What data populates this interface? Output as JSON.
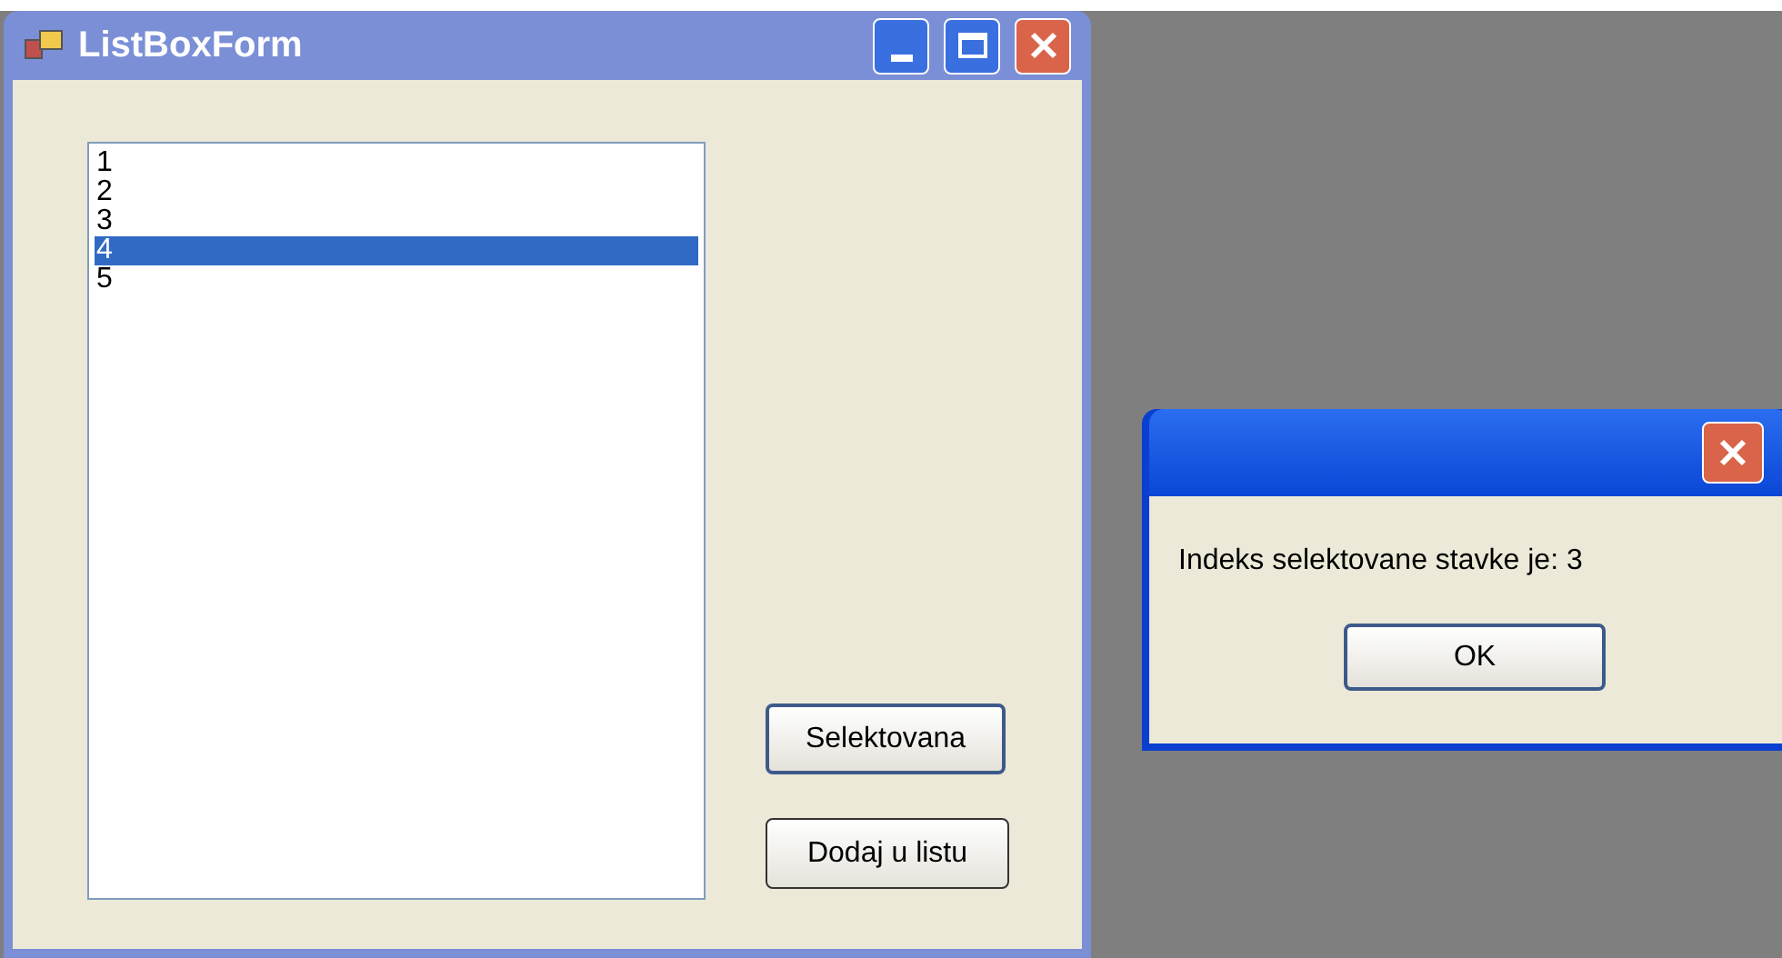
{
  "main_window": {
    "title": "ListBoxForm",
    "list_items": [
      {
        "label": "1",
        "selected": false
      },
      {
        "label": "2",
        "selected": false
      },
      {
        "label": "3",
        "selected": false
      },
      {
        "label": "4",
        "selected": true
      },
      {
        "label": "5",
        "selected": false
      }
    ],
    "buttons": [
      "Selektovana",
      "Dodaj u listu"
    ]
  },
  "message_box": {
    "message": "Indeks selektovane stavke je: 3",
    "button": "OK"
  }
}
